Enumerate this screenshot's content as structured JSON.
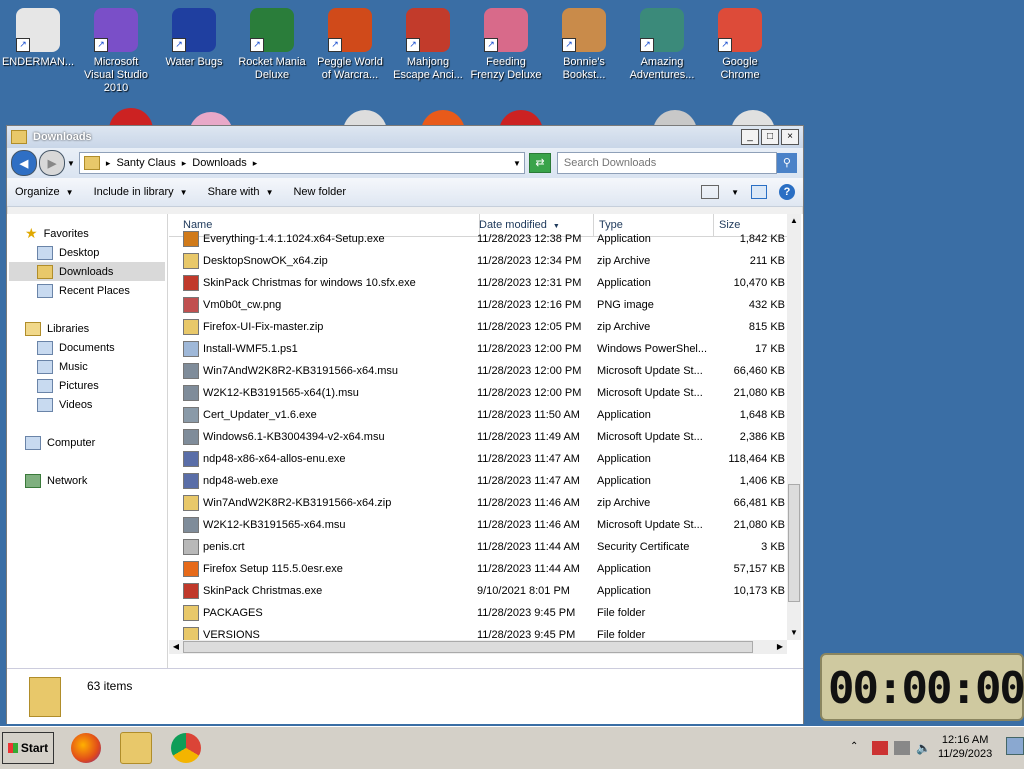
{
  "desktop": {
    "icons": [
      {
        "label": "ENDERMAN...",
        "color": "#e6e6e6"
      },
      {
        "label": "Microsoft Visual Studio 2010",
        "color": "#7a4fc8"
      },
      {
        "label": "Water Bugs",
        "color": "#1f3fa0"
      },
      {
        "label": "Rocket Mania Deluxe",
        "color": "#2a7d3a"
      },
      {
        "label": "Peggle World of Warcra...",
        "color": "#d04a1a"
      },
      {
        "label": "Mahjong Escape Anci...",
        "color": "#c23b2b"
      },
      {
        "label": "Feeding Frenzy Deluxe",
        "color": "#d86a8a"
      },
      {
        "label": "Bonnie's Bookst...",
        "color": "#c98b4a"
      },
      {
        "label": "Amazing Adventures...",
        "color": "#3b8a7a"
      },
      {
        "label": "Google Chrome",
        "color": "#dd4b39"
      }
    ]
  },
  "window": {
    "title": "Downloads",
    "controls": {
      "minimize": "_",
      "maximize": "□",
      "close": "×"
    },
    "address": {
      "crumbs": [
        "Santy Claus",
        "Downloads"
      ],
      "separator": "▸"
    },
    "search": {
      "placeholder": "Search Downloads"
    },
    "commands": {
      "organize": "Organize",
      "include_in_library": "Include in library",
      "share_with": "Share with",
      "new_folder": "New folder"
    },
    "columns": {
      "name": "Name",
      "date": "Date modified",
      "type": "Type",
      "size": "Size"
    },
    "nav": {
      "favorites": "Favorites",
      "desktop": "Desktop",
      "downloads": "Downloads",
      "recent_places": "Recent Places",
      "libraries": "Libraries",
      "documents": "Documents",
      "music": "Music",
      "pictures": "Pictures",
      "videos": "Videos",
      "computer": "Computer",
      "network": "Network"
    },
    "files": [
      {
        "name": "Everything-1.4.1.1024.x64-Setup.exe",
        "date": "11/28/2023 12:38 PM",
        "type": "Application",
        "size": "1,842 KB",
        "icon_color": "#d07a1a"
      },
      {
        "name": "DesktopSnowOK_x64.zip",
        "date": "11/28/2023 12:34 PM",
        "type": "zip Archive",
        "size": "211 KB",
        "icon_color": "#e8c86a"
      },
      {
        "name": "SkinPack Christmas for windows 10.sfx.exe",
        "date": "11/28/2023 12:31 PM",
        "type": "Application",
        "size": "10,470 KB",
        "icon_color": "#c0392b"
      },
      {
        "name": "Vm0b0t_cw.png",
        "date": "11/28/2023 12:16 PM",
        "type": "PNG image",
        "size": "432 KB",
        "icon_color": "#c05050"
      },
      {
        "name": "Firefox-UI-Fix-master.zip",
        "date": "11/28/2023 12:05 PM",
        "type": "zip Archive",
        "size": "815 KB",
        "icon_color": "#e8c86a"
      },
      {
        "name": "Install-WMF5.1.ps1",
        "date": "11/28/2023 12:00 PM",
        "type": "Windows PowerShel...",
        "size": "17 KB",
        "icon_color": "#9fb8d8"
      },
      {
        "name": "Win7AndW2K8R2-KB3191566-x64.msu",
        "date": "11/28/2023 12:00 PM",
        "type": "Microsoft Update St...",
        "size": "66,460 KB",
        "icon_color": "#7f8c9a"
      },
      {
        "name": "W2K12-KB3191565-x64(1).msu",
        "date": "11/28/2023 12:00 PM",
        "type": "Microsoft Update St...",
        "size": "21,080 KB",
        "icon_color": "#7f8c9a"
      },
      {
        "name": "Cert_Updater_v1.6.exe",
        "date": "11/28/2023 11:50 AM",
        "type": "Application",
        "size": "1,648 KB",
        "icon_color": "#8a9aa8"
      },
      {
        "name": "Windows6.1-KB3004394-v2-x64.msu",
        "date": "11/28/2023 11:49 AM",
        "type": "Microsoft Update St...",
        "size": "2,386 KB",
        "icon_color": "#7f8c9a"
      },
      {
        "name": "ndp48-x86-x64-allos-enu.exe",
        "date": "11/28/2023 11:47 AM",
        "type": "Application",
        "size": "118,464 KB",
        "icon_color": "#5a6ea8"
      },
      {
        "name": "ndp48-web.exe",
        "date": "11/28/2023 11:47 AM",
        "type": "Application",
        "size": "1,406 KB",
        "icon_color": "#5a6ea8"
      },
      {
        "name": "Win7AndW2K8R2-KB3191566-x64.zip",
        "date": "11/28/2023 11:46 AM",
        "type": "zip Archive",
        "size": "66,481 KB",
        "icon_color": "#e8c86a"
      },
      {
        "name": "W2K12-KB3191565-x64.msu",
        "date": "11/28/2023 11:46 AM",
        "type": "Microsoft Update St...",
        "size": "21,080 KB",
        "icon_color": "#7f8c9a"
      },
      {
        "name": "penis.crt",
        "date": "11/28/2023 11:44 AM",
        "type": "Security Certificate",
        "size": "3 KB",
        "icon_color": "#b8b8b8"
      },
      {
        "name": "Firefox Setup 115.5.0esr.exe",
        "date": "11/28/2023 11:44 AM",
        "type": "Application",
        "size": "57,157 KB",
        "icon_color": "#e66a1a"
      },
      {
        "name": "SkinPack Christmas.exe",
        "date": "9/10/2021 8:01 PM",
        "type": "Application",
        "size": "10,173 KB",
        "icon_color": "#c0392b"
      },
      {
        "name": "PACKAGES",
        "date": "11/28/2023 9:45 PM",
        "type": "File folder",
        "size": "",
        "icon_color": "#e8c86a"
      },
      {
        "name": "VERSIONS",
        "date": "11/28/2023 9:45 PM",
        "type": "File folder",
        "size": "",
        "icon_color": "#e8c86a"
      }
    ],
    "status": {
      "item_count": "63 items"
    }
  },
  "timer": {
    "display": "00:00:00"
  },
  "taskbar": {
    "start_label": "Start",
    "clock_time": "12:16 AM",
    "clock_date": "11/29/2023"
  }
}
